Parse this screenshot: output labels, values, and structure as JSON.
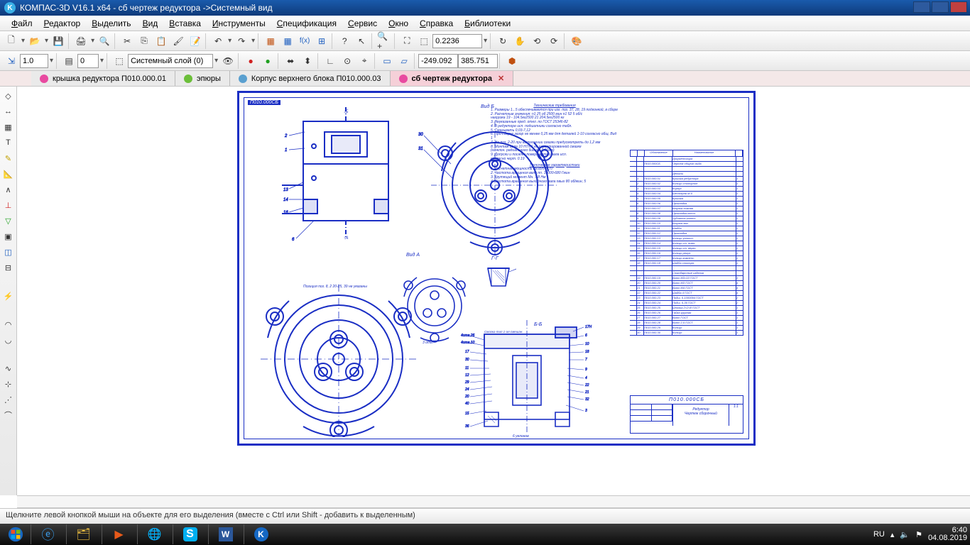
{
  "title": "КОМПАС-3D V16.1 x64 - сб чертеж редуктора ->Системный вид",
  "menu": [
    "Файл",
    "Редактор",
    "Выделить",
    "Вид",
    "Вставка",
    "Инструменты",
    "Спецификация",
    "Сервис",
    "Окно",
    "Справка",
    "Библиотеки"
  ],
  "toolbar1": {
    "zoom_value": "0.2236"
  },
  "toolbar2": {
    "step": "1.0",
    "style": "0",
    "layer": "Системный слой (0)",
    "coord_x": "-249.092",
    "coord_y": "385.751"
  },
  "tabs": [
    {
      "label": "крышка редуктора П010.000.01",
      "color": "#e84aa0"
    },
    {
      "label": "эпюры",
      "color": "#6cbf3a"
    },
    {
      "label": "Корпус верхнего блока П010.000.03",
      "color": "#5aa0d0"
    },
    {
      "label": "сб чертеж редуктора",
      "color": "#e84aa0",
      "active": true
    }
  ],
  "drawing": {
    "header": "П010.000СБ",
    "views": {
      "top": "Вид Б",
      "mid": "Вид А",
      "sec1": "Г-Г",
      "sec2": "Б-Б"
    },
    "notes_title": "Технические требования",
    "notes_lines": [
      "1. Размеры 1...5 обеспечиваются при изг. поз. 37, 28, 19 подгонкой, в сборе",
      "2. Расчетные значения: n1 25 об 2500 мин n1 52 5 об/с",
      "   нагрузка 19 - 104.5кг2500 21 204.5кг2500 кг",
      "3. Неуказанные пред. откл. по ГОСТ 25346-82",
      "4. В редукторе исп. подшипники согласно табл.",
      "5. Смазывать 0,03-7,12",
      "6. При сборке зазор не менее 0,25 мм для деталей 1-10 согласно общ. Вид 1",
      "7. На поз. 2-20 при выполнении смазки предусмотреть до 1,2 мм",
      "8. Монтаж вала 10 Н7/h6 на гарантированной смазке",
      "   (отклон. радиального биения 0,01мм)",
      "9. Допуски и посадки поверхностей вала исп.",
      "   согласно черт. 0.19"
    ],
    "char_title": "Технические характеристики",
    "char_lines": [
      "1. Расчетная мощность 260Вт = 70",
      "2. Частота вращения вала nп. 10000-680 Гмин",
      "3. Крутящий момент Мн. 7,8 Нм",
      "4. Частота вращения выходного вала nвых 80 об/мин, 5"
    ],
    "spec_header": "Обозначение / Наименование",
    "spec_rows": [
      {
        "z": "",
        "p": "",
        "o": "",
        "n": "Документация",
        "k": ""
      },
      {
        "z": "",
        "p": "",
        "o": "П010.000СБ",
        "n": "Чертеж общего вида",
        "k": ""
      },
      {
        "z": "",
        "p": "",
        "o": "",
        "n": "",
        "k": ""
      },
      {
        "z": "",
        "p": "",
        "o": "",
        "n": "Детали",
        "k": ""
      },
      {
        "z": "",
        "p": "1",
        "o": "П010.000.01",
        "n": "Крышка редуктора",
        "k": "1"
      },
      {
        "z": "",
        "p": "2",
        "o": "П010.000.02",
        "n": "Кольцо стопорное",
        "k": "1"
      },
      {
        "z": "",
        "p": "3",
        "o": "П010.000.03",
        "n": "Корпус",
        "k": "1"
      },
      {
        "z": "",
        "p": "4",
        "o": "П010.000.04",
        "n": "Шестерня M-0",
        "k": "1"
      },
      {
        "z": "",
        "p": "5",
        "o": "П010.000.05",
        "n": "Крышка",
        "k": "1"
      },
      {
        "z": "",
        "p": "6",
        "o": "П010.000.06",
        "n": "Прокладка",
        "k": "1"
      },
      {
        "z": "",
        "p": "7",
        "o": "П010.000.07",
        "n": "Втулка нижняя",
        "k": "1"
      },
      {
        "z": "",
        "p": "8",
        "o": "П010.000.08",
        "n": "Прокладка конич.",
        "k": "1"
      },
      {
        "z": "",
        "p": "9",
        "o": "П010.000.09",
        "n": "Зубчатое колесо",
        "k": "1"
      },
      {
        "z": "",
        "p": "10",
        "o": "П010.000.10",
        "n": "Втулка вал",
        "k": "1"
      },
      {
        "z": "",
        "p": "11",
        "o": "П010.000.11",
        "n": "Шайба",
        "k": "1"
      },
      {
        "z": "",
        "p": "12",
        "o": "П010.000.12",
        "n": "Прокладка",
        "k": "1"
      },
      {
        "z": "",
        "p": "13",
        "o": "П010.000.13",
        "n": "Кольцо уплотн.",
        "k": "1"
      },
      {
        "z": "",
        "p": "14",
        "o": "П010.000.14",
        "n": "Кольцо ст. нижн.",
        "k": "1"
      },
      {
        "z": "",
        "p": "15",
        "o": "П010.000.15",
        "n": "Кольцо ст. верхн.",
        "k": "1"
      },
      {
        "z": "",
        "p": "16",
        "o": "П010.000.16",
        "n": "Кольцо регул.",
        "k": "1"
      },
      {
        "z": "",
        "p": "17",
        "o": "П010.000.17",
        "n": "Кольцо компенс.",
        "k": "1"
      },
      {
        "z": "",
        "p": "18",
        "o": "П010.000.18",
        "n": "Шайба стопорн.",
        "k": "1"
      },
      {
        "z": "",
        "p": "",
        "o": "",
        "n": "",
        "k": ""
      },
      {
        "z": "",
        "p": "",
        "o": "",
        "n": "Стандартные изделия",
        "k": ""
      },
      {
        "z": "",
        "p": "19",
        "o": "П010.000.19",
        "n": "Винт М3×10 ГОСТ",
        "k": "3"
      },
      {
        "z": "",
        "p": "20",
        "o": "П010.000.20",
        "n": "Винт М3 ГОСТ",
        "k": "4"
      },
      {
        "z": "",
        "p": "21",
        "o": "П010.000.21",
        "n": "Винт М4 ГОСТ",
        "k": "4"
      },
      {
        "z": "",
        "p": "22",
        "o": "П010.000.22",
        "n": "Шайба 4 ГОСТ",
        "k": "4"
      },
      {
        "z": "",
        "p": "23",
        "o": "П010.000.23",
        "n": "Подш. 6-1000094 ГОСТ",
        "k": "2"
      },
      {
        "z": "",
        "p": "24",
        "o": "П010.000.24",
        "n": "Подш. 6-36 ГОСТ",
        "k": "2"
      },
      {
        "z": "",
        "p": "25",
        "o": "П010.000.25",
        "n": "Шпонка 2×2×8 ГОСТ",
        "k": "1"
      },
      {
        "z": "",
        "p": "26",
        "o": "П010.000.26",
        "n": "Гайка круглая",
        "k": "1"
      },
      {
        "z": "",
        "p": "27",
        "o": "П010.000.27",
        "n": "Винт ГОСТ",
        "k": "1"
      },
      {
        "z": "",
        "p": "28",
        "o": "П010.000.28",
        "n": "Винт 2,5 ГОСТ",
        "k": "1"
      },
      {
        "z": "",
        "p": "29",
        "o": "П010.000.29",
        "n": "Кольцо",
        "k": "1"
      },
      {
        "z": "",
        "p": "30",
        "o": "П010.000.30",
        "n": "Кольцо",
        "k": "1"
      }
    ],
    "titleblock": {
      "code": "П010.000СБ",
      "name1": "Редуктор",
      "name2": "Чертеж сборочный"
    }
  },
  "status": "Щелкните левой кнопкой мыши на объекте для его выделения (вместе с Ctrl или Shift - добавить к выделенным)",
  "tray": {
    "lang": "RU",
    "time": "6:40",
    "date": "04.08.2019"
  }
}
